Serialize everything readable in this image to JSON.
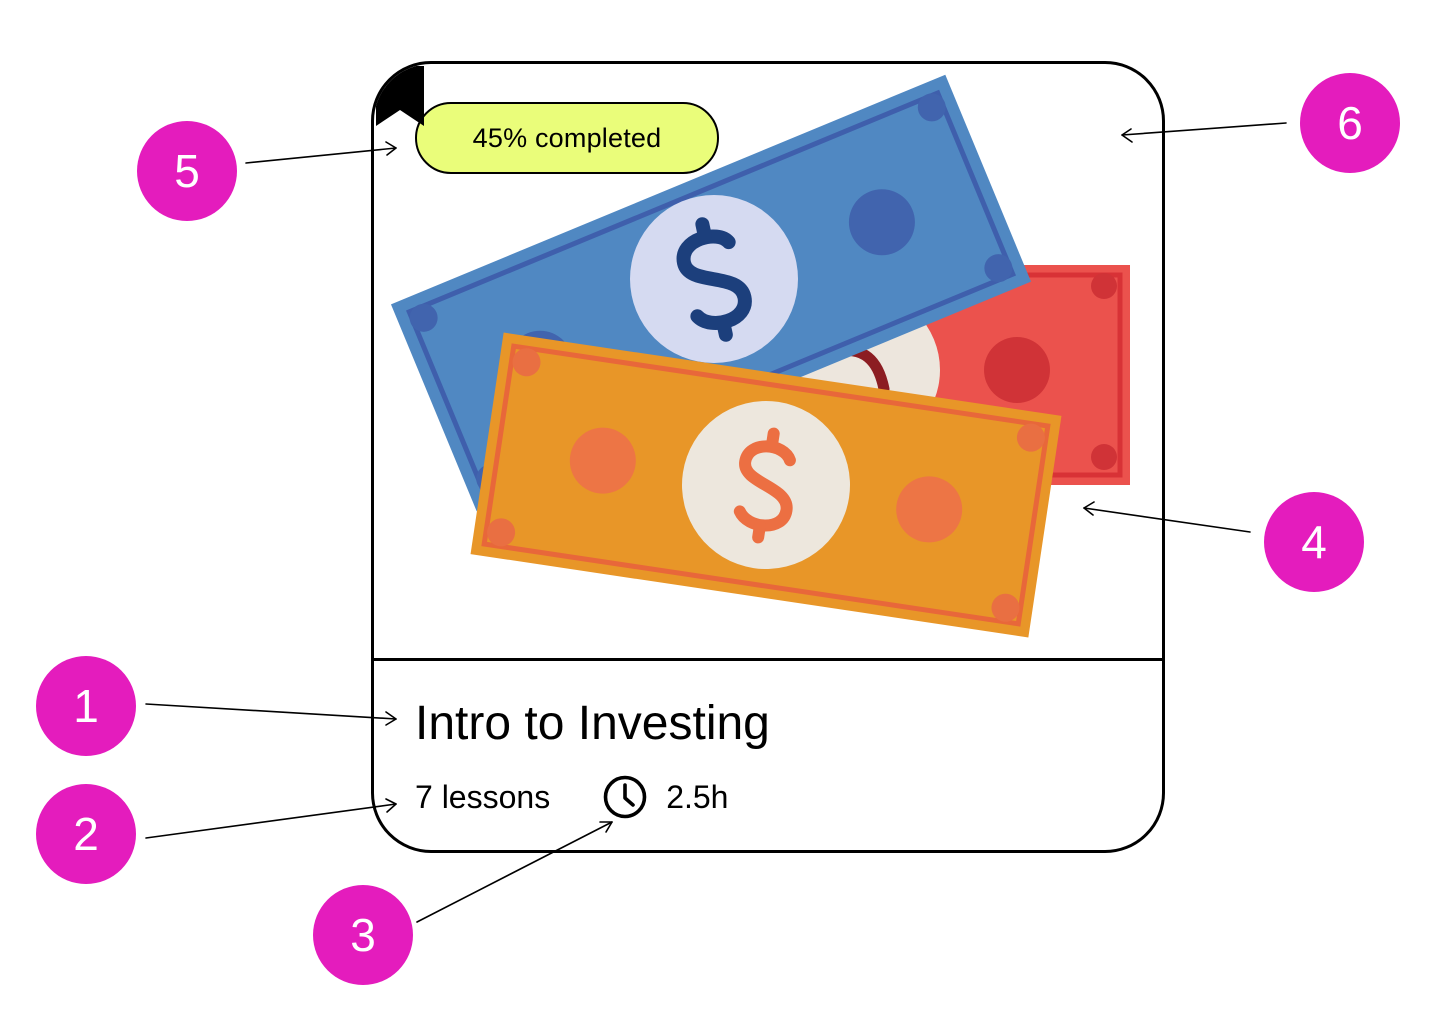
{
  "card": {
    "progress_label": "45% completed",
    "progress_fraction": 0.45,
    "title": "Intro to Investing",
    "lessons": "7 lessons",
    "duration": "2.5h",
    "image_icon": "money-bills-illustration",
    "bookmark_icon": "bookmark-icon",
    "clock_icon": "clock-icon"
  },
  "callouts": [
    "1",
    "2",
    "3",
    "4",
    "5",
    "6"
  ],
  "colors": {
    "pill": "#eafd7a",
    "callout": "#e41cbd",
    "bill_blue": "#5088c2",
    "bill_red": "#eb524d",
    "bill_orange": "#e89628"
  }
}
